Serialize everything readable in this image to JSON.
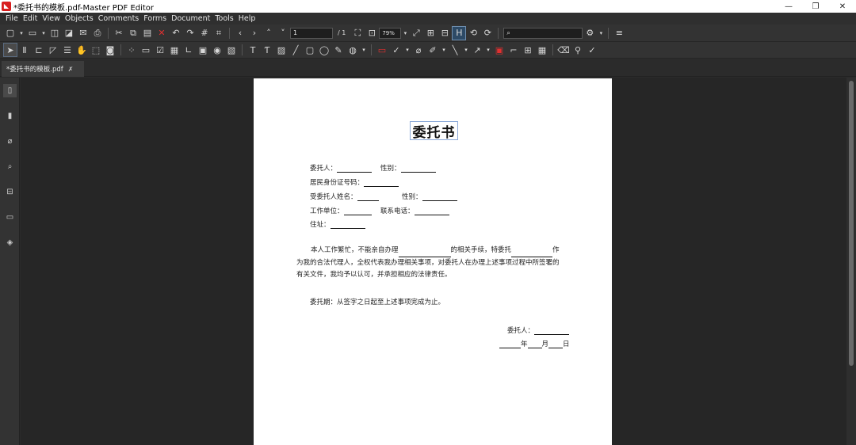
{
  "window": {
    "title": "*委托书的模板.pdf-Master PDF Editor",
    "app_icon": "pdf-app-icon",
    "minimize": "—",
    "restore": "❐",
    "close": "✕"
  },
  "menu": [
    "File",
    "Edit",
    "View",
    "Objects",
    "Comments",
    "Forms",
    "Document",
    "Tools",
    "Help"
  ],
  "toolbar1": {
    "page_value": "1",
    "page_total": "/ 1",
    "zoom_value": "79%",
    "search_value": ""
  },
  "tab": {
    "label": "*委托书的模板.pdf",
    "close": "✗"
  },
  "document": {
    "title": "委托书",
    "principal_label": "委托人：",
    "gender_label": "性别：",
    "id_label": "居民身份证号码：",
    "agent_label": "受委托人姓名：",
    "gender2_label": "性别：",
    "work_label": "工作单位：",
    "phone_label": "联系电话：",
    "address_label": "住址：",
    "body_1a": "本人工作繁忙，不能亲自办理",
    "body_1b": "的相关手续，特委托",
    "body_1c": "作",
    "body_2": "为我的合法代理人，全权代表我办理相关事项，对委托人在办理上述事项过程中所签署的",
    "body_3": "有关文件，我均予以认可，并承担相应的法律责任。",
    "period": "委托期：从签字之日起至上述事项完成为止。",
    "sign_label": "委托人：",
    "year": "年",
    "month": "月",
    "day": "日"
  },
  "colors": {
    "title_border": "#8aa8d8",
    "app_icon": "#d81e1e",
    "highlight": "#2d4a66"
  }
}
